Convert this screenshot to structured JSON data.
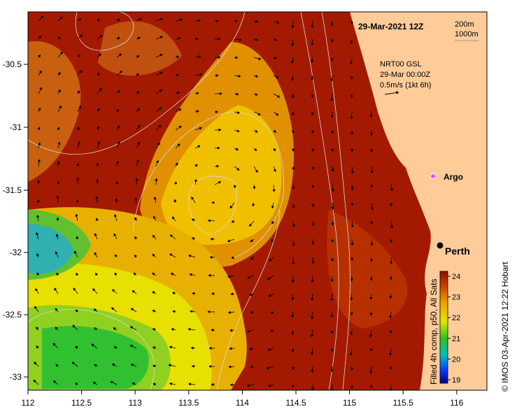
{
  "map": {
    "timestamp": "29-Mar-2021 12Z",
    "legend_lines": [
      "200m",
      "1000m"
    ],
    "current_model": "NRT00 GSL",
    "current_time": "29-Mar 00:00Z",
    "current_scale": "0.5m/s (1kt 6h)",
    "float_label": "Argo",
    "city_label": "Perth",
    "x_ticks": [
      "112",
      "112.5",
      "113",
      "113.5",
      "114",
      "114.5",
      "115",
      "115.5",
      "116"
    ],
    "y_ticks": [
      "-30.5",
      "-31",
      "-31.5",
      "-32",
      "-32.5",
      "-33"
    ],
    "colorbar_title": "Filled 4h comp, p50, All Sats",
    "colorbar_ticks": [
      "24",
      "23",
      "22",
      "21",
      "20",
      "19"
    ],
    "credit": "© IMOS 03-Apr-2021 12:22 Hobart",
    "colors": {
      "land": "#ffcc99",
      "warm": "#a31a00",
      "mid": "#e8a000",
      "cool": "#f2ec00",
      "cold": "#30c020"
    }
  }
}
